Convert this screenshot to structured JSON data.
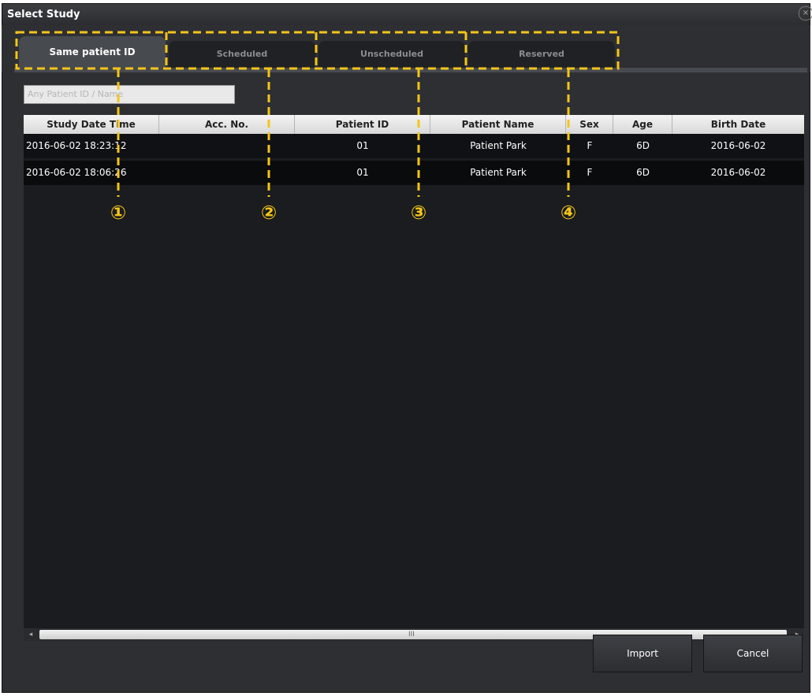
{
  "window": {
    "title": "Select Study",
    "close_glyph": "×"
  },
  "tabs": [
    {
      "label": "Same patient ID",
      "active": true
    },
    {
      "label": "Scheduled",
      "active": false
    },
    {
      "label": "Unscheduled",
      "active": false
    },
    {
      "label": "Reserved",
      "active": false
    }
  ],
  "search": {
    "placeholder": "Any Patient ID / Name"
  },
  "table": {
    "columns": [
      "Study Date Time",
      "Acc. No.",
      "Patient ID",
      "Patient Name",
      "Sex",
      "Age",
      "Birth Date"
    ],
    "rows": [
      [
        "2016-06-02 18:23:12",
        "",
        "01",
        "Patient Park",
        "F",
        "6D",
        "2016-06-02"
      ],
      [
        "2016-06-02 18:06:26",
        "",
        "01",
        "Patient Park",
        "F",
        "6D",
        "2016-06-02"
      ]
    ]
  },
  "scrollbar": {
    "grip": "III",
    "left_arrow": "◂",
    "right_arrow": "▸"
  },
  "buttons": {
    "import_label": "Import",
    "cancel_label": "Cancel"
  },
  "annotations": {
    "markers": [
      "①",
      "②",
      "③",
      "④"
    ],
    "color": "#f5c518"
  }
}
